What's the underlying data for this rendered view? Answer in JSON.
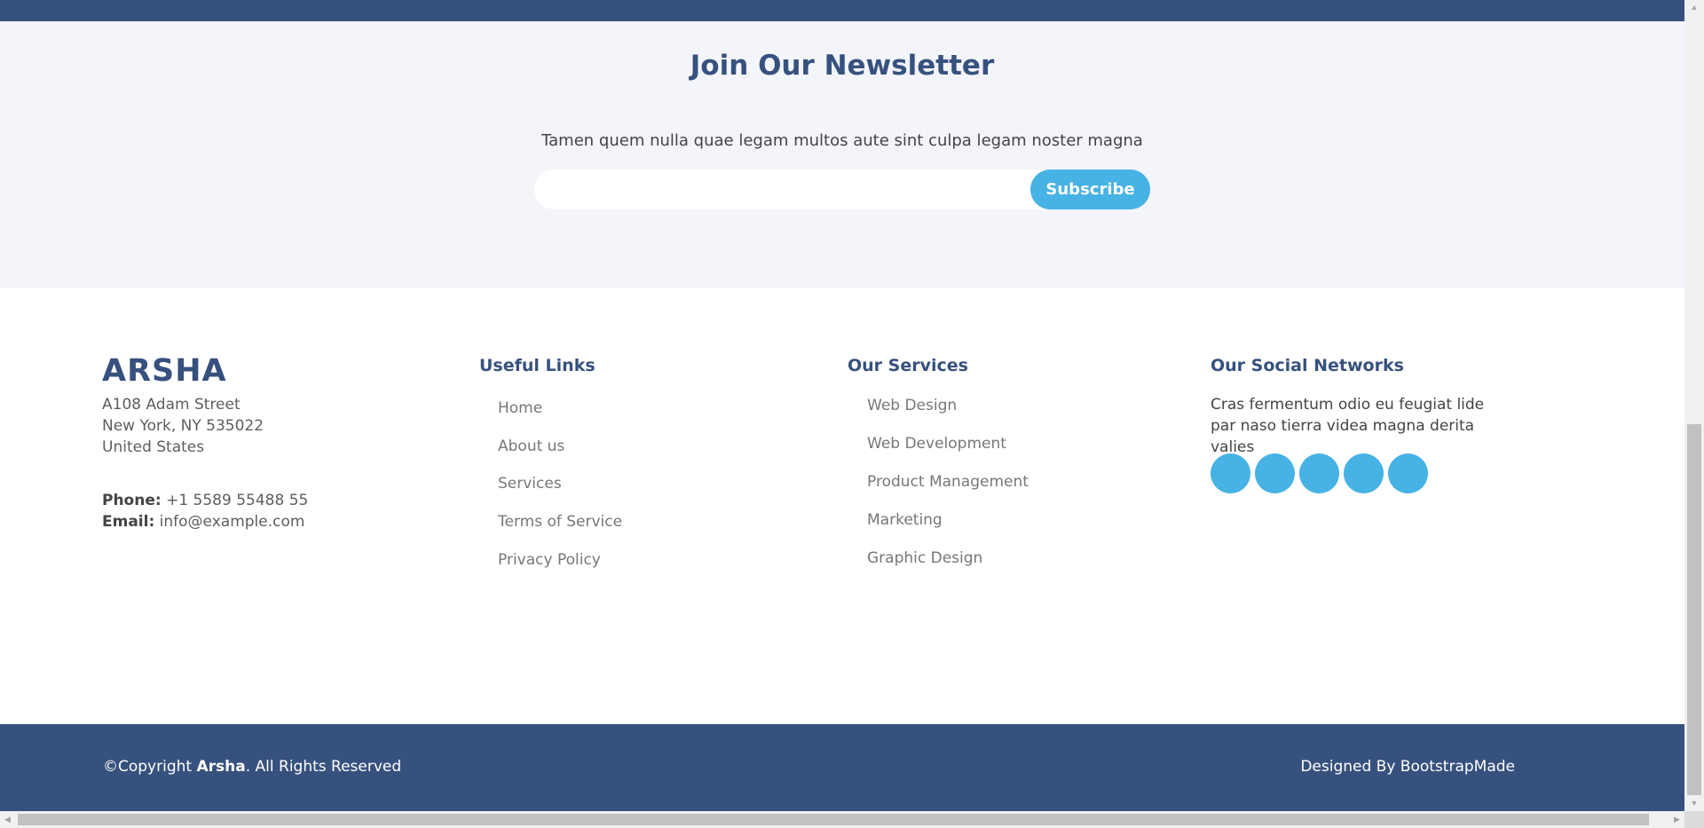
{
  "newsletter": {
    "title": "Join Our Newsletter",
    "description": "Tamen quem nulla quae legam multos aute sint culpa legam noster magna",
    "email_value": "",
    "subscribe_label": "Subscribe"
  },
  "footer": {
    "brand": "ARSHA",
    "address_line1": "A108 Adam Street",
    "address_line2": "New York, NY 535022",
    "address_line3": "United States",
    "phone_label": "Phone:",
    "phone_value": "+1 5589 55488 55",
    "email_label": "Email:",
    "email_value": "info@example.com",
    "useful_links": {
      "title": "Useful Links",
      "items": [
        "Home",
        "About us",
        "Services",
        "Terms of Service",
        "Privacy Policy"
      ]
    },
    "services": {
      "title": "Our Services",
      "items": [
        "Web Design",
        "Web Development",
        "Product Management",
        "Marketing",
        "Graphic Design"
      ]
    },
    "social": {
      "title": "Our Social Networks",
      "text": "Cras fermentum odio eu feugiat lide par naso tierra videa magna derita valies",
      "buttons": [
        "twitter-icon",
        "facebook-icon",
        "instagram-icon",
        "skype-icon",
        "linkedin-icon"
      ]
    }
  },
  "bottom": {
    "copyright_prefix": "©Copyright ",
    "copyright_brand": "Arsha",
    "copyright_suffix": ". All Rights Reserved",
    "credits": "Designed By BootstrapMade"
  },
  "colors": {
    "primary": "#37517e",
    "accent": "#47b2e4",
    "newsletter_bg": "#f3f5fa"
  }
}
